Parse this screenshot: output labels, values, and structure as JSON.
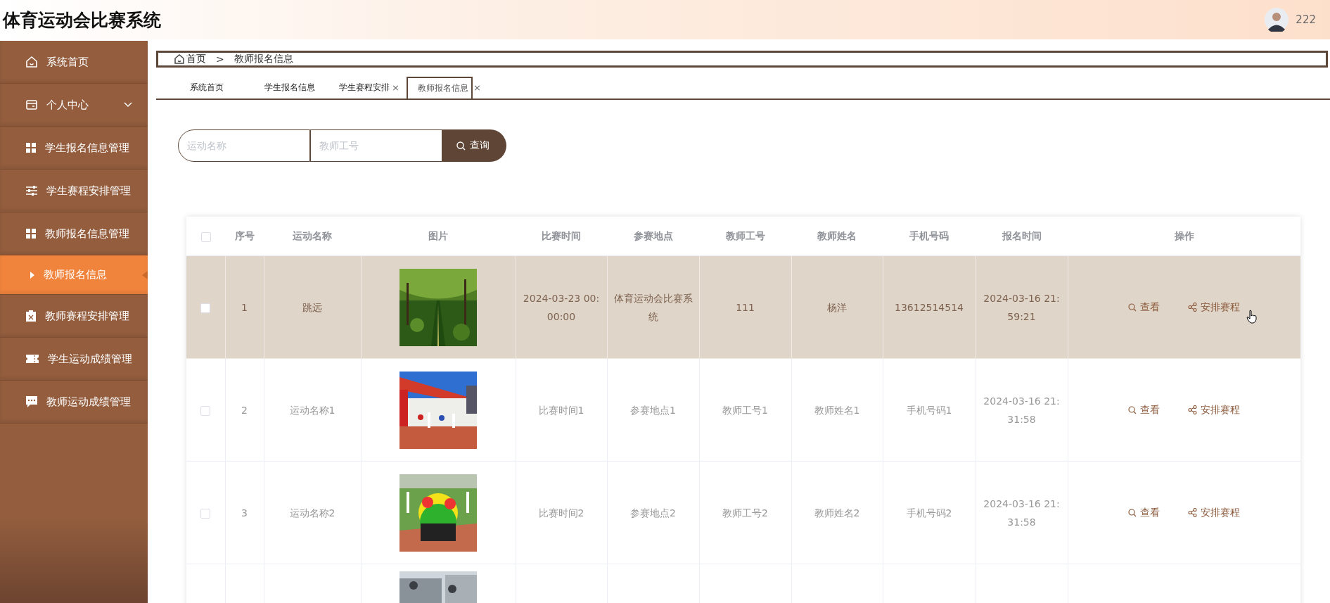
{
  "header": {
    "title": "体育运动会比赛系统",
    "username": "222"
  },
  "sidebar": {
    "items": [
      {
        "label": "系统首页",
        "kind": "link",
        "selected": false
      },
      {
        "label": "个人中心",
        "kind": "group",
        "expanded": false,
        "selected": false
      },
      {
        "label": "学生报名信息管理",
        "kind": "link",
        "selected": false
      },
      {
        "label": "学生赛程安排管理",
        "kind": "link",
        "selected": false
      },
      {
        "label": "教师报名信息管理",
        "kind": "link",
        "selected": false
      },
      {
        "label": "教师报名信息",
        "kind": "subitem",
        "selected": true
      },
      {
        "label": "教师赛程安排管理",
        "kind": "link",
        "selected": false
      },
      {
        "label": "学生运动成绩管理",
        "kind": "link",
        "selected": false
      },
      {
        "label": "教师运动成绩管理",
        "kind": "link",
        "selected": false
      }
    ]
  },
  "breadcrumb": {
    "home": "首页",
    "separator": ">",
    "current": "教师报名信息"
  },
  "tabs": [
    {
      "label": "系统首页",
      "selected": false
    },
    {
      "label": "学生报名信息",
      "selected": false
    },
    {
      "label": "学生赛程安排",
      "close": "×",
      "selected": false
    },
    {
      "label": "教师报名信息",
      "close": "×",
      "selected": true
    }
  ],
  "search": {
    "fields": [
      {
        "placeholder": "运动名称"
      },
      {
        "placeholder": "教师工号"
      }
    ],
    "button": "查询"
  },
  "table": {
    "header_checked": false,
    "columns": [
      "序号",
      "运动名称",
      "图片",
      "比赛时间",
      "参赛地点",
      "教师工号",
      "教师姓名",
      "手机号码",
      "报名时间",
      "操作"
    ],
    "rows": [
      {
        "selected": true,
        "checked": false,
        "cells": [
          "1",
          "跳远",
          null,
          "2024-03-23 00:00:00",
          "体育运动会比赛系统",
          "111",
          "杨洋",
          "13612514514",
          "2024-03-16 21:59:21"
        ],
        "image": {
          "kind": "picture"
        },
        "actions": [
          "查看",
          "安排赛程"
        ]
      },
      {
        "selected": false,
        "checked": false,
        "cells": [
          "2",
          "运动名称1",
          null,
          "比赛时间1",
          "参赛地点1",
          "教师工号1",
          "教师姓名1",
          "手机号码1",
          "2024-03-16 21:31:58"
        ],
        "image": {
          "kind": "picture"
        },
        "actions": [
          "查看",
          "安排赛程"
        ]
      },
      {
        "selected": false,
        "checked": false,
        "cells": [
          "3",
          "运动名称2",
          null,
          "比赛时间2",
          "参赛地点2",
          "教师工号2",
          "教师姓名2",
          "手机号码2",
          "2024-03-16 21:31:58"
        ],
        "image": {
          "kind": "picture"
        },
        "actions": [
          "查看",
          "安排赛程"
        ]
      },
      {
        "selected": false,
        "image": {
          "kind": "picture"
        }
      }
    ]
  }
}
